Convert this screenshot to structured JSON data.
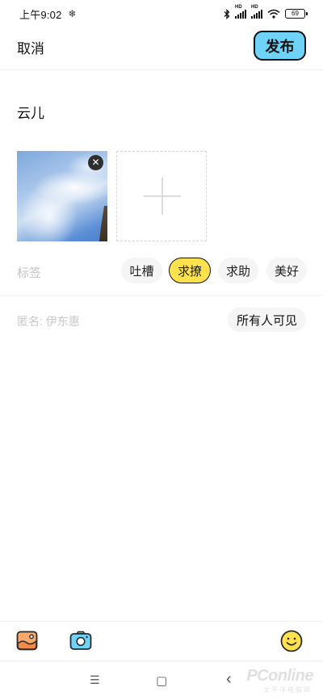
{
  "status_bar": {
    "time": "上午9:02",
    "battery": "69"
  },
  "header": {
    "cancel_label": "取消",
    "publish_label": "发布"
  },
  "post": {
    "content": "云儿"
  },
  "tags": {
    "label": "标签",
    "items": [
      "吐槽",
      "求撩",
      "求助",
      "美好"
    ],
    "selected": "求撩"
  },
  "options": {
    "anonymous_placeholder": "匿名: 伊东惠",
    "visibility": "所有人可见"
  },
  "toolbar": {
    "icons": [
      "image-icon",
      "camera-icon",
      "emoji-icon"
    ]
  },
  "nav_bar": {
    "menu_glyph": "☰",
    "home_glyph": "▢",
    "back_glyph": "‹"
  },
  "watermark": {
    "text": "PConline",
    "sub": "太平洋电脑网"
  },
  "colors": {
    "publish_bg": "#6ed3f7",
    "selected_tag_bg": "#fde24e",
    "emoji_bg": "#fde24e"
  }
}
